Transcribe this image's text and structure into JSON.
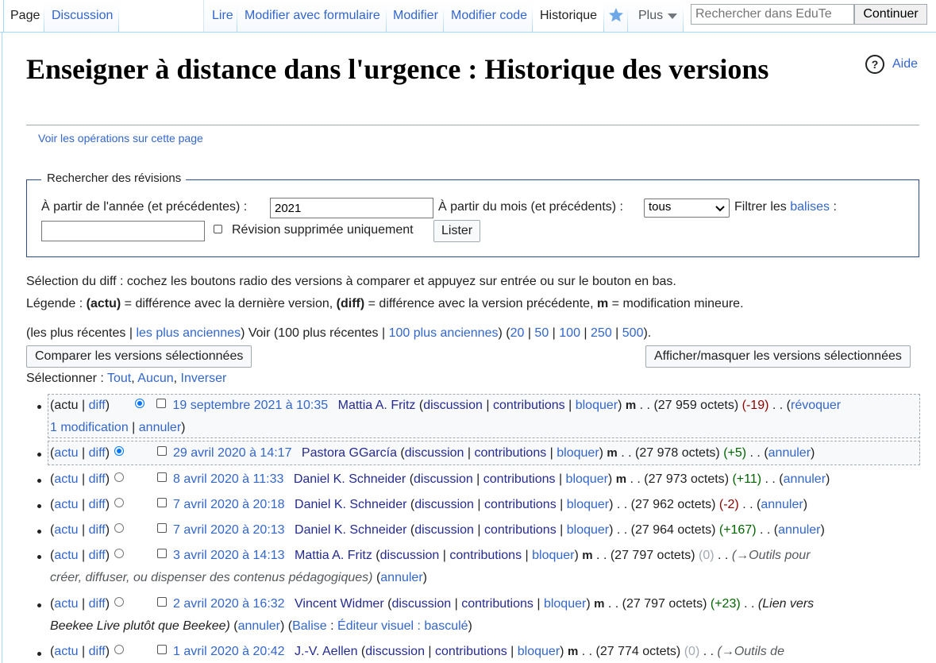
{
  "tabs": {
    "left": [
      {
        "label": "Page",
        "selected": true
      },
      {
        "label": "Discussion",
        "selected": false
      }
    ],
    "right": [
      {
        "label": "Lire",
        "selected": false
      },
      {
        "label": "Modifier avec formulaire",
        "selected": false
      },
      {
        "label": "Modifier",
        "selected": false
      },
      {
        "label": "Modifier code",
        "selected": false
      },
      {
        "label": "Historique",
        "selected": true
      }
    ],
    "more_label": "Plus"
  },
  "search": {
    "placeholder": "Rechercher dans EduTe",
    "button": "Continuer"
  },
  "page": {
    "title": "Enseigner à distance dans l'urgence : Historique des versions",
    "help": "Aide",
    "ops_link": "Voir les opérations sur cette page"
  },
  "revsearch": {
    "legend": "Rechercher des révisions",
    "year_label": "À partir de l'année (et précédentes) :",
    "year_value": "2021",
    "month_label": "À partir du mois (et précédents) :",
    "month_value": "tous",
    "filter_label": "Filtrer les",
    "filter_link": "balises",
    "filter_colon": ":",
    "deleted_label": "Révision supprimée uniquement",
    "list_button": "Lister"
  },
  "help_text": {
    "diff_selection": "Sélection du diff : cochez les boutons radio des versions à comparer et appuyez sur entrée ou sur le bouton en bas.",
    "legend_prefix": "Légende :",
    "legend_actu": "(actu)",
    "legend_actu_desc": "= différence avec la dernière version,",
    "legend_diff": "(diff)",
    "legend_diff_desc": "= différence avec la version précédente,",
    "legend_m": "m",
    "legend_m_desc": "= modification mineure."
  },
  "nav": {
    "recent": "les plus récentes",
    "oldest": "les plus anciennes",
    "voir": "Voir",
    "recent100": "100 plus récentes",
    "oldest100": "100 plus anciennes",
    "limits": [
      "20",
      "50",
      "100",
      "250",
      "500"
    ]
  },
  "buttons": {
    "compare": "Comparer les versions sélectionnées",
    "toggle": "Afficher/masquer les versions sélectionnées"
  },
  "select": {
    "label": "Sélectionner :",
    "all": "Tout",
    "none": "Aucun",
    "invert": "Inverser"
  },
  "links": {
    "actu": "actu",
    "diff": "diff",
    "discussion": "discussion",
    "contributions": "contributions",
    "bloquer": "bloquer",
    "annuler": "annuler",
    "minor": "m"
  },
  "history": [
    {
      "date": "19 septembre 2021 à 10:35",
      "user": "Mattia A. Fritz",
      "minor": true,
      "size": "27 959 octets",
      "delta": "-19",
      "extra_line": "1 modification",
      "extra_link1": "révoquer"
    },
    {
      "date": "29 avril 2020 à 14:17",
      "user": "Pastora GGarcía",
      "minor": true,
      "size": "27 978 octets",
      "delta": "+5"
    },
    {
      "date": "8 avril 2020 à 11:33",
      "user": "Daniel K. Schneider",
      "minor": true,
      "size": "27 973 octets",
      "delta": "+11"
    },
    {
      "date": "7 avril 2020 à 20:18",
      "user": "Daniel K. Schneider",
      "minor": false,
      "size": "27 962 octets",
      "delta": "-2"
    },
    {
      "date": "7 avril 2020 à 20:13",
      "user": "Daniel K. Schneider",
      "minor": false,
      "size": "27 964 octets",
      "delta": "+167"
    },
    {
      "date": "3 avril 2020 à 14:13",
      "user": "Mattia A. Fritz",
      "minor": true,
      "size": "27 797 octets",
      "delta": "0",
      "comment": "(→Outils pour",
      "comment2": "créer, diffuser, ou dispenser des contenus pédagogiques)"
    },
    {
      "date": "2 avril 2020 à 16:32",
      "user": "Vincent Widmer",
      "minor": true,
      "size": "27 797 octets",
      "delta": "+23",
      "comment": "(Lien vers",
      "comment2": "Beekee Live plutôt que Beekee)",
      "tag_label": "Balise",
      "tag_value": "Éditeur visuel : basculé"
    },
    {
      "date": "1 avril 2020 à 20:42",
      "user": "J.-V. Aellen",
      "minor": true,
      "size": "27 774 octets",
      "delta": "0",
      "comment": "(→Outils de"
    }
  ]
}
